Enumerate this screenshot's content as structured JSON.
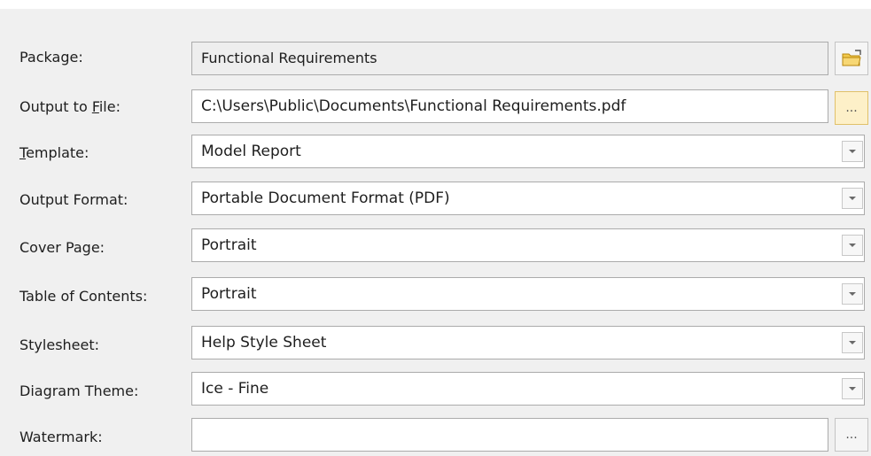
{
  "form": {
    "package": {
      "label": "Package:",
      "value": "Functional Requirements"
    },
    "output_file": {
      "label_pre": "Output to ",
      "label_accel": "F",
      "label_post": "ile:",
      "value": "C:\\Users\\Public\\Documents\\Functional Requirements.pdf",
      "browse_label": "..."
    },
    "template": {
      "label_accel": "T",
      "label_post": "emplate:",
      "value": "Model Report"
    },
    "output_format": {
      "label": "Output Format:",
      "value": "Portable Document Format (PDF)"
    },
    "cover_page": {
      "label": "Cover Page:",
      "value": "Portrait"
    },
    "table_of_contents": {
      "label": "Table of Contents:",
      "value": "Portrait"
    },
    "stylesheet": {
      "label": "Stylesheet:",
      "value": "Help Style Sheet"
    },
    "diagram_theme": {
      "label": "Diagram Theme:",
      "value": "Ice - Fine"
    },
    "watermark": {
      "label": "Watermark:",
      "value": "",
      "browse_label": "..."
    }
  },
  "icons": {
    "package_select": "folder-icon",
    "dropdown": "chevron-down-icon"
  },
  "colors": {
    "readonly_bg": "#eeeeee",
    "active_button_bg": "#fdf0c8",
    "border": "#ababab"
  }
}
